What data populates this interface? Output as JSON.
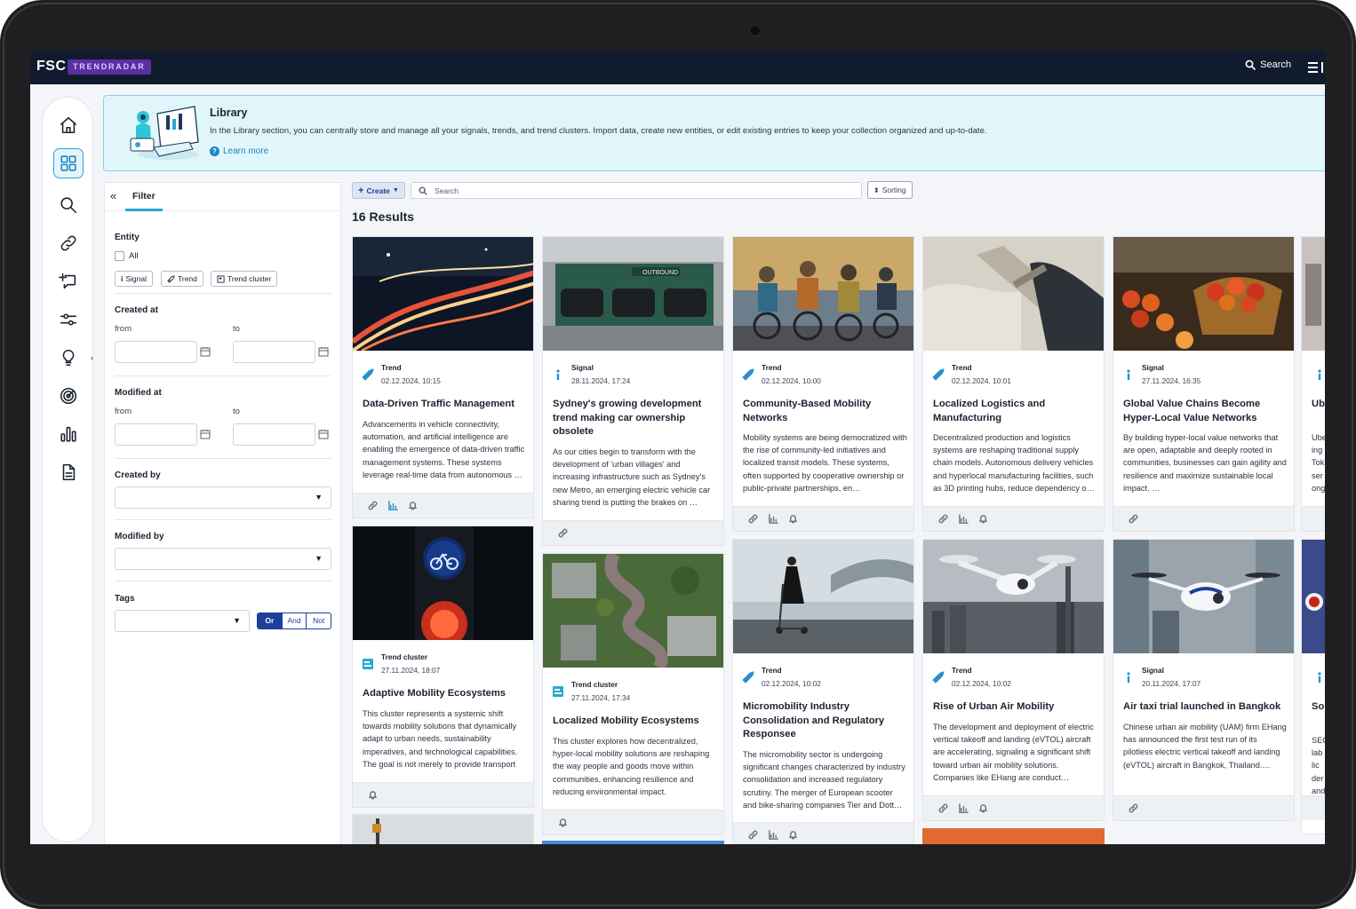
{
  "app": {
    "logo": "FSC",
    "product": "TRENDRADAR",
    "search_label": "Search"
  },
  "banner": {
    "title": "Library",
    "text": "In the Library section, you can centrally store and manage all your signals, trends, and trend clusters. Import data, create new entities, or edit existing entries to keep your collection organized and up-to-date.",
    "link": "Learn more"
  },
  "filter": {
    "tab": "Filter",
    "entity_label": "Entity",
    "all_label": "All",
    "chips": [
      "Signal",
      "Trend",
      "Trend cluster"
    ],
    "created_at_label": "Created at",
    "modified_at_label": "Modified at",
    "from_label": "from",
    "to_label": "to",
    "created_by_label": "Created by",
    "modified_by_label": "Modified by",
    "tags_label": "Tags",
    "logic": [
      "Or",
      "And",
      "Not"
    ]
  },
  "toolbar": {
    "create_label": "Create",
    "search_placeholder": "Search",
    "sort_label": "Sorting"
  },
  "results_label": "16 Results",
  "cards": [
    {
      "type": "Trend",
      "date": "02.12.2024, 10:15",
      "title": "Data-Driven Traffic Management",
      "desc": "Advancements in vehicle connectivity, automation, and artificial intelligence are enabling the emergence of data-driven traffic management systems. These systems leverage real-time data from autonomous …"
    },
    {
      "type": "Signal",
      "date": "28.11.2024, 17:24",
      "title": "Sydney's growing development trend making car ownership obsolete",
      "desc": "As our cities begin to transform with the development of 'urban villages' and increasing infrastructure such as Sydney's new Metro, an emerging electric vehicle car sharing trend is putting the brakes on …"
    },
    {
      "type": "Trend",
      "date": "02.12.2024, 10:00",
      "title": "Community-Based Mobility Networks",
      "desc": "Mobility systems are being democratized with the rise of community-led initiatives and localized transit models. These systems, often supported by cooperative ownership or public-private partnerships, en…"
    },
    {
      "type": "Trend",
      "date": "02.12.2024, 10:01",
      "title": "Localized Logistics and Manufacturing",
      "desc": "Decentralized production and logistics systems are reshaping traditional supply chain models. Autonomous delivery vehicles and hyperlocal manufacturing facilities, such as 3D printing hubs, reduce dependency o…"
    },
    {
      "type": "Signal",
      "date": "27.11.2024, 16:35",
      "title": "Global Value Chains Become Hyper-Local Value Networks",
      "desc": "By building hyper-local value networks that are open, adaptable and deeply rooted in communities, businesses can gain agility and resilience and maximize sustainable local impact. …"
    },
    {
      "type": "Trend cluster",
      "date": "27.11.2024, 18:07",
      "title": "Adaptive Mobility Ecosystems",
      "desc": "This cluster represents a systemic shift towards mobility solutions that dynamically adapt to urban needs, sustainability imperatives, and technological capabilities. The goal is not merely to provide transport bu…"
    },
    {
      "type": "Trend cluster",
      "date": "27.11.2024, 17:34",
      "title": "Localized Mobility Ecosystems",
      "desc": "This cluster explores how decentralized, hyper-local mobility solutions are reshaping the way people and goods move within communities, enhancing resilience and reducing environmental impact."
    },
    {
      "type": "Trend",
      "date": "02.12.2024, 10:02",
      "title": "Micromobility Industry Consolidation and Regulatory Responsee",
      "desc": "The micromobility sector is undergoing significant changes characterized by industry consolidation and increased regulatory scrutiny. The merger of European scooter and bike-sharing companies Tier and Dott…"
    },
    {
      "type": "Trend",
      "date": "02.12.2024, 10:02",
      "title": "Rise of Urban Air Mobility",
      "desc": "The development and deployment of electric vertical takeoff and landing (eVTOL) aircraft are accelerating, signaling a significant shift toward urban air mobility solutions. Companies like EHang are conduct…"
    },
    {
      "type": "Signal",
      "date": "20.11.2024, 17:07",
      "title": "Air taxi trial launched in Bangkok",
      "desc": "Chinese urban air mobility (UAM) firm EHang has announced the first test run of its pilotless electric vertical takeoff and landing (eVTOL) aircraft in Bangkok, Thailand.…"
    },
    {
      "type": "Signal",
      "date": "",
      "title": "Ub wit",
      "desc": "Ube ing Tok ser ong"
    },
    {
      "type": "Signal",
      "date": "",
      "title": "So Bu",
      "desc": "SEC lab lic der and"
    }
  ],
  "colors": {
    "nav": "#101c2e",
    "accent": "#2ea3d6",
    "trend": "#2a8fd0",
    "signal": "#2a8fd0",
    "cluster": "#2aa8d0"
  }
}
